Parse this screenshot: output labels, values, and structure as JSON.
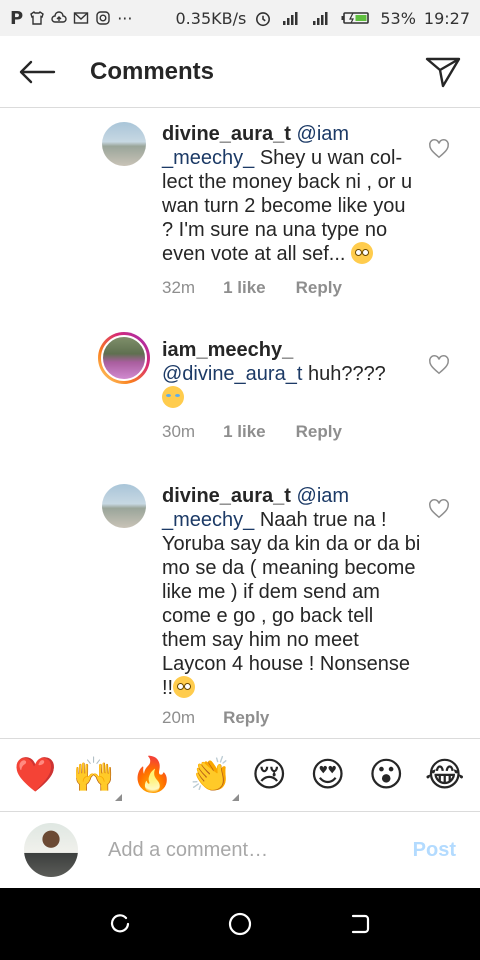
{
  "status_bar": {
    "net_speed": "0.35KB/s",
    "battery": "53%",
    "time": "19:27"
  },
  "header": {
    "title": "Comments"
  },
  "comments": [
    {
      "username": "divine_aura_t",
      "mention": "@iam _meechy_",
      "text": " Shey u wan col- lect the money back ni , or u wan turn 2 become like you ?  I'm sure na una type no even vote at all sef...",
      "emoji": "face-with-rolling-eyes",
      "time": "32m",
      "likes": "1 like",
      "reply": "Reply"
    },
    {
      "username": "iam_meechy_",
      "mention": "@divine_aura_t",
      "text": " huh????",
      "emoji": "face-with-tears-of-joy",
      "time": "30m",
      "likes": "1 like",
      "reply": "Reply"
    },
    {
      "username": "divine_aura_t",
      "mention": "@iam _meechy_",
      "text": " Naah true na ! Yoruba say da kin da or da bi mo se da ( meaning become like me ) if dem send am come e go , go back tell them say him no meet Laycon 4 house ! Nonsense !!",
      "emoji": "face-with-rolling-eyes",
      "time": "20m",
      "likes": "",
      "reply": "Reply"
    }
  ],
  "reactions": [
    "❤️",
    "🙌",
    "🔥",
    "👏",
    "😢",
    "😍",
    "😮",
    "😂"
  ],
  "composer": {
    "placeholder": "Add a comment…",
    "post_label": "Post"
  }
}
